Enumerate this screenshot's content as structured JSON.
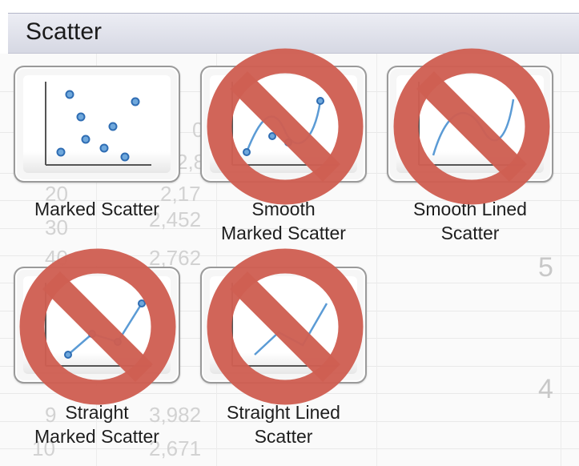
{
  "header": {
    "title": "Scatter"
  },
  "chart_types": [
    {
      "id": "marked-scatter",
      "lines": [
        "Marked Scatter"
      ],
      "disabled": false
    },
    {
      "id": "smooth-marked-scatter",
      "lines": [
        "Smooth",
        "Marked Scatter"
      ],
      "disabled": true
    },
    {
      "id": "smooth-lined-scatter",
      "lines": [
        "Smooth Lined",
        "Scatter"
      ],
      "disabled": true
    },
    {
      "id": "straight-marked-scatter",
      "lines": [
        "Straight",
        "Marked Scatter"
      ],
      "disabled": true
    },
    {
      "id": "straight-lined-scatter",
      "lines": [
        "Straight Lined",
        "Scatter"
      ],
      "disabled": true
    }
  ],
  "background_sheet": {
    "cells": [
      "0",
      "2,82",
      "20",
      "2,17",
      "30",
      "2,452",
      "40",
      "2,762",
      "5",
      "4",
      "9",
      "3,982",
      "10",
      "2,671"
    ]
  },
  "colors": {
    "ban": "#cf5f52",
    "marker": "#4a86c5",
    "line": "#5b9bd5",
    "axis": "#555555"
  }
}
